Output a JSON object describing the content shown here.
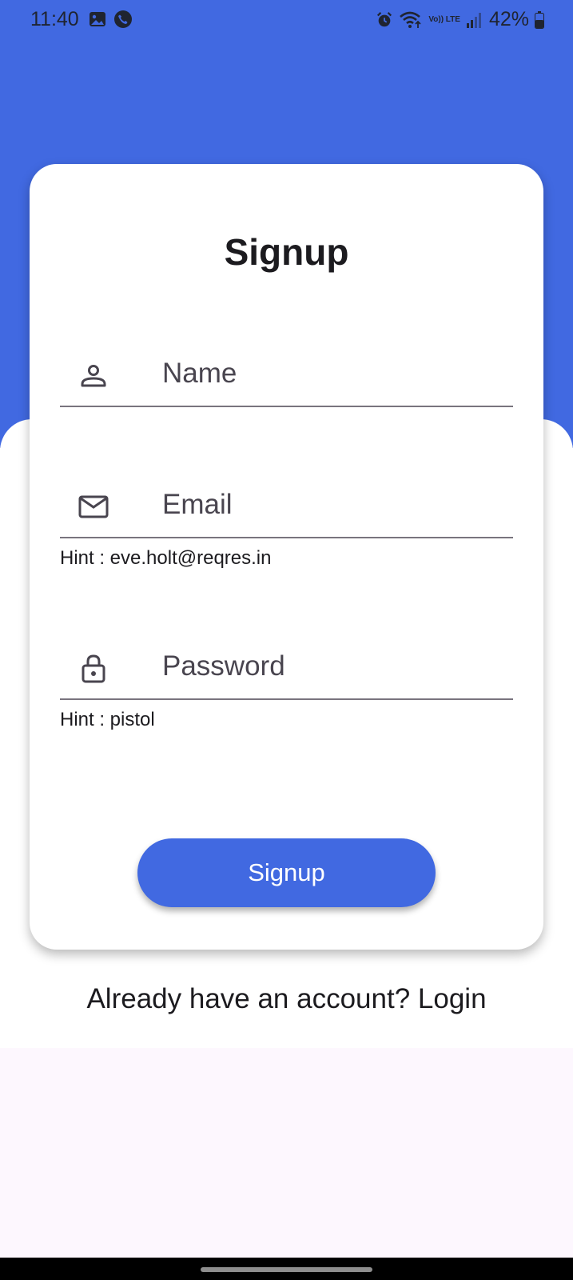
{
  "status_bar": {
    "time": "11:40",
    "battery": "42%",
    "network": "Vo)) LTE",
    "left_icons": [
      "gallery-icon",
      "phone-call-icon"
    ],
    "right_icons": [
      "alarm-icon",
      "wifi-icon",
      "volte-icon",
      "signal-icon",
      "battery-icon"
    ]
  },
  "form": {
    "title": "Signup",
    "name_label": "Name",
    "email_label": "Email",
    "email_hint": "Hint : eve.holt@reqres.in",
    "password_label": "Password",
    "password_hint": "Hint : pistol",
    "submit_label": "Signup"
  },
  "footer": {
    "login_prompt": "Already have an account? Login"
  },
  "colors": {
    "primary": "#4169E1",
    "card": "#FFFFFF",
    "background": "#FDF7FE",
    "text": "#1C1B1F",
    "label": "#49454F",
    "divider": "#79747E"
  }
}
